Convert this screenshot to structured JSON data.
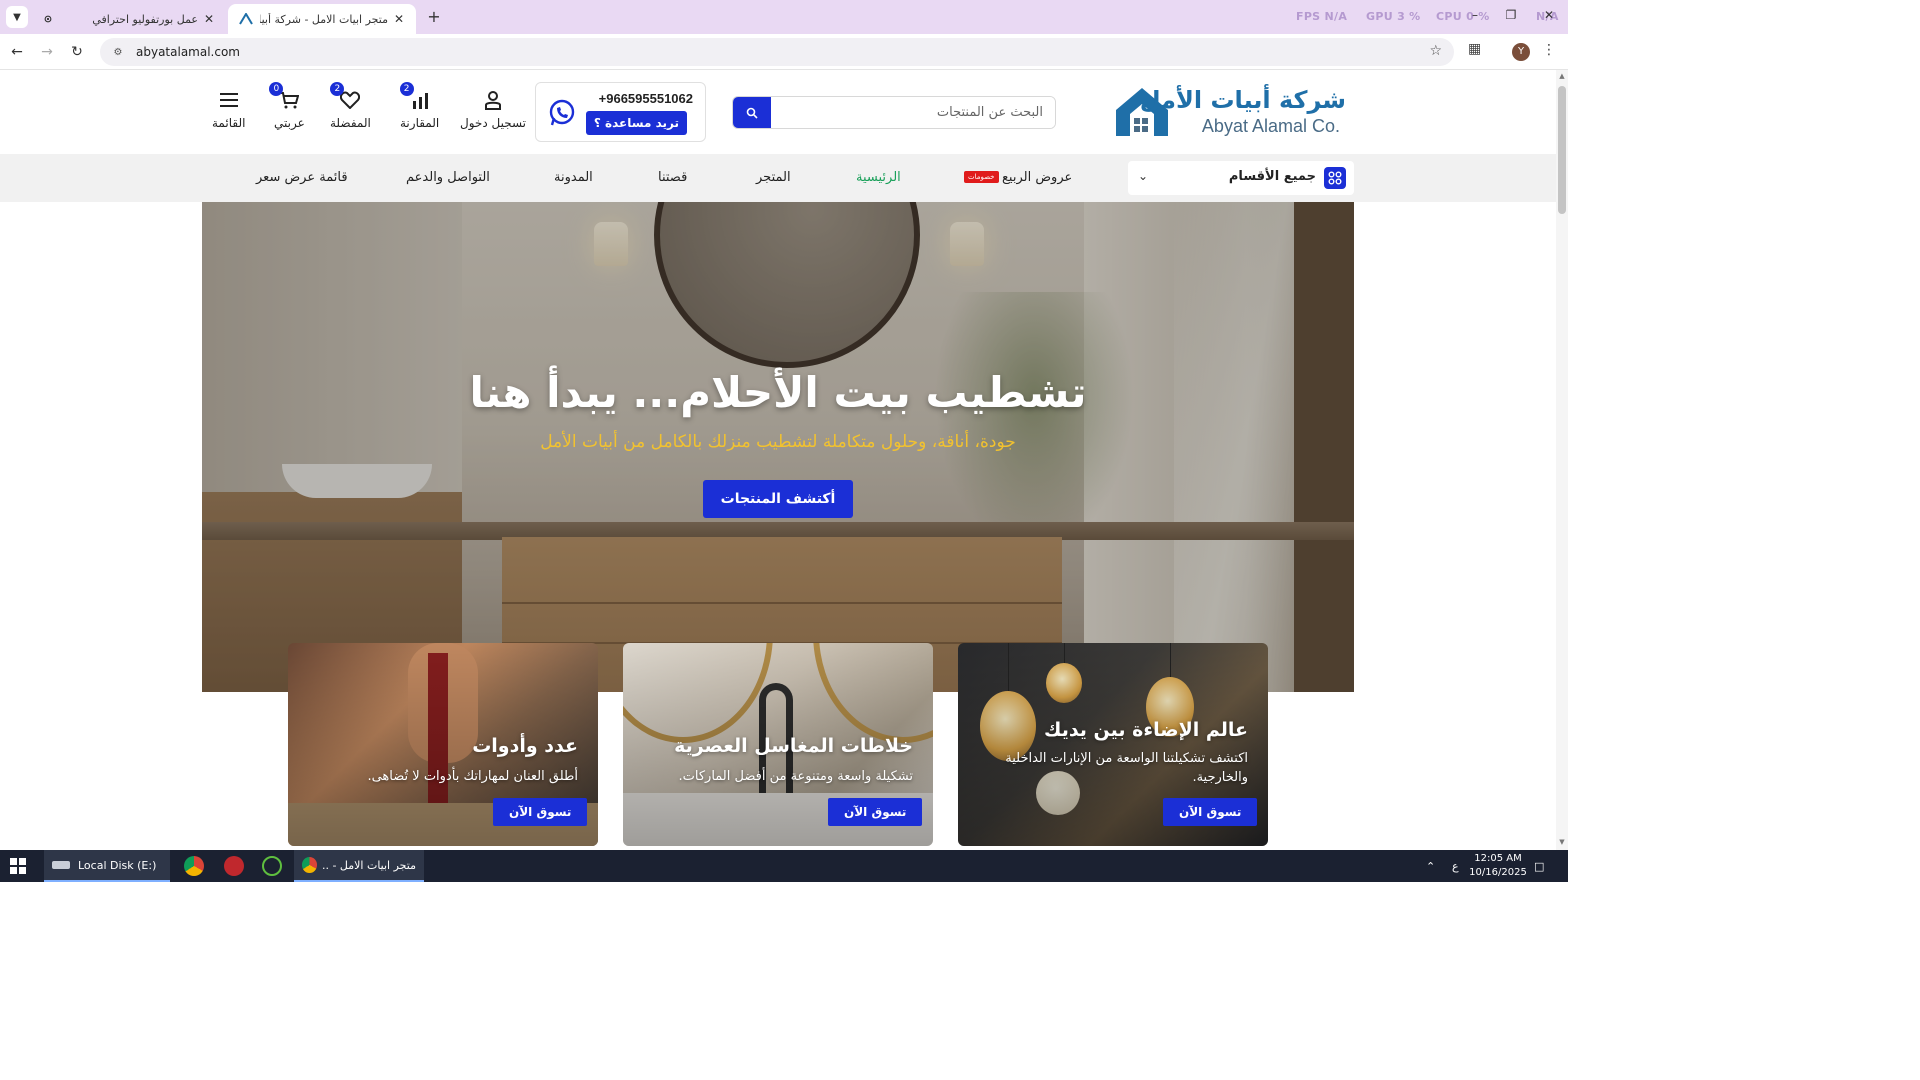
{
  "browser": {
    "tabs": [
      {
        "title": "عمل بورتفوليو احترافي"
      },
      {
        "title": "متجر ابيات الامل - شركة أبيات الأمل",
        "active": true
      }
    ],
    "perf": {
      "fps_label": "FPS",
      "fps_value": "N/A",
      "gpu_label": "GPU",
      "gpu_value": "3 %",
      "cpu_label": "CPU",
      "cpu_value": "0 %",
      "lat_value": "N/A"
    },
    "url": "abyatalamal.com",
    "profile_initial": "Y"
  },
  "header": {
    "logo_ar": "شركة أبيات الأمل",
    "logo_en": "Abyat Alamal Co.",
    "search_placeholder": "البحث عن المنتجات",
    "phone": "+966595551062",
    "help_label": "تريد مساعدة ؟",
    "actions": {
      "login": "تسجيل دخول",
      "compare": "المقارنة",
      "compare_count": "2",
      "wishlist": "المفضلة",
      "wishlist_count": "2",
      "cart": "عربتي",
      "cart_count": "0",
      "menu": "القائمة"
    }
  },
  "nav": {
    "all_categories": "جميع الأقسام",
    "items": [
      {
        "label": "عروض الربيع",
        "badge": "خصومات"
      },
      {
        "label": "الرئيسية",
        "active": true
      },
      {
        "label": "المتجر"
      },
      {
        "label": "قصتنا"
      },
      {
        "label": "المدونة"
      },
      {
        "label": "التواصل والدعم"
      },
      {
        "label": "قائمة عرض سعر"
      }
    ]
  },
  "hero": {
    "title": "تشطيب بيت الأحلام... يبدأ هنا",
    "subtitle": "جودة، أناقة، وحلول متكاملة لتشطيب منزلك بالكامل من أبيات الأمل",
    "cta": "أكتشف المنتجات"
  },
  "cards": [
    {
      "title": "عالم الإضاءة بين يديك",
      "desc": "اكتشف تشكيلتنا الواسعة من الإنارات الداخلية والخارجية.",
      "button": "تسوق الآن"
    },
    {
      "title": "خلاطات المغاسل العصرية",
      "desc": "تشكيلة واسعة ومتنوعة من أفضل الماركات.",
      "button": "تسوق الآن"
    },
    {
      "title": "عدد وأدوات",
      "desc": "أطلق العنان لمهاراتك بأدوات لا تُضاهى.",
      "button": "تسوق الآن"
    }
  ],
  "taskbar": {
    "explorer": "Local Disk (E:)",
    "chrome_window": "متجر ابيات الامل - ...",
    "lang": "ع",
    "time": "12:05 AM",
    "date": "10/16/2025"
  },
  "colors": {
    "accent": "#1b2fd6",
    "nav_active": "#1aa05a",
    "hero_subtitle": "#f2c22f",
    "badge_red": "#e01b1b"
  }
}
